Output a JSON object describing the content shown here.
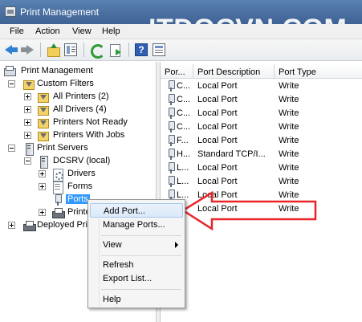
{
  "window": {
    "title": "Print Management",
    "watermark": "ITDOCVN.COM"
  },
  "menu": {
    "file": "File",
    "action": "Action",
    "view": "View",
    "help": "Help"
  },
  "toolbar": {
    "icons": [
      "back-arrow-icon",
      "forward-arrow-icon",
      "up-folder-icon",
      "show-hide-tree-icon",
      "refresh-icon",
      "export-list-icon",
      "help-icon",
      "properties-icon"
    ]
  },
  "tree": {
    "root": "Print Management",
    "custom_filters": "Custom Filters",
    "all_printers": "All Printers (2)",
    "all_drivers": "All Drivers (4)",
    "printers_not_ready": "Printers Not Ready",
    "printers_with_jobs": "Printers With Jobs",
    "print_servers": "Print Servers",
    "dcsrv": "DCSRV (local)",
    "drivers": "Drivers",
    "forms": "Forms",
    "ports": "Ports",
    "printers": "Printe",
    "deployed_printers": "Deployed Prin"
  },
  "list": {
    "columns": [
      "Por...",
      "Port Description",
      "Port Type"
    ],
    "rows": [
      {
        "port": "C...",
        "description": "Local Port",
        "type": "Write"
      },
      {
        "port": "C...",
        "description": "Local Port",
        "type": "Write"
      },
      {
        "port": "C...",
        "description": "Local Port",
        "type": "Write"
      },
      {
        "port": "C...",
        "description": "Local Port",
        "type": "Write"
      },
      {
        "port": "F...",
        "description": "Local Port",
        "type": "Write"
      },
      {
        "port": "H...",
        "description": "Standard TCP/I...",
        "type": "Write"
      },
      {
        "port": "L...",
        "description": "Local Port",
        "type": "Write"
      },
      {
        "port": "L...",
        "description": "Local Port",
        "type": "Write"
      },
      {
        "port": "L...",
        "description": "Local Port",
        "type": "Write"
      },
      {
        "port": "",
        "description": "Local Port",
        "type": "Write"
      }
    ]
  },
  "context_menu": {
    "add_port": "Add Port...",
    "manage_ports": "Manage Ports...",
    "view": "View",
    "refresh": "Refresh",
    "export_list": "Export List...",
    "help": "Help"
  },
  "colors": {
    "selection": "#3399ff",
    "callout": "#e8262a",
    "titlebar": "#4a6fa0"
  }
}
